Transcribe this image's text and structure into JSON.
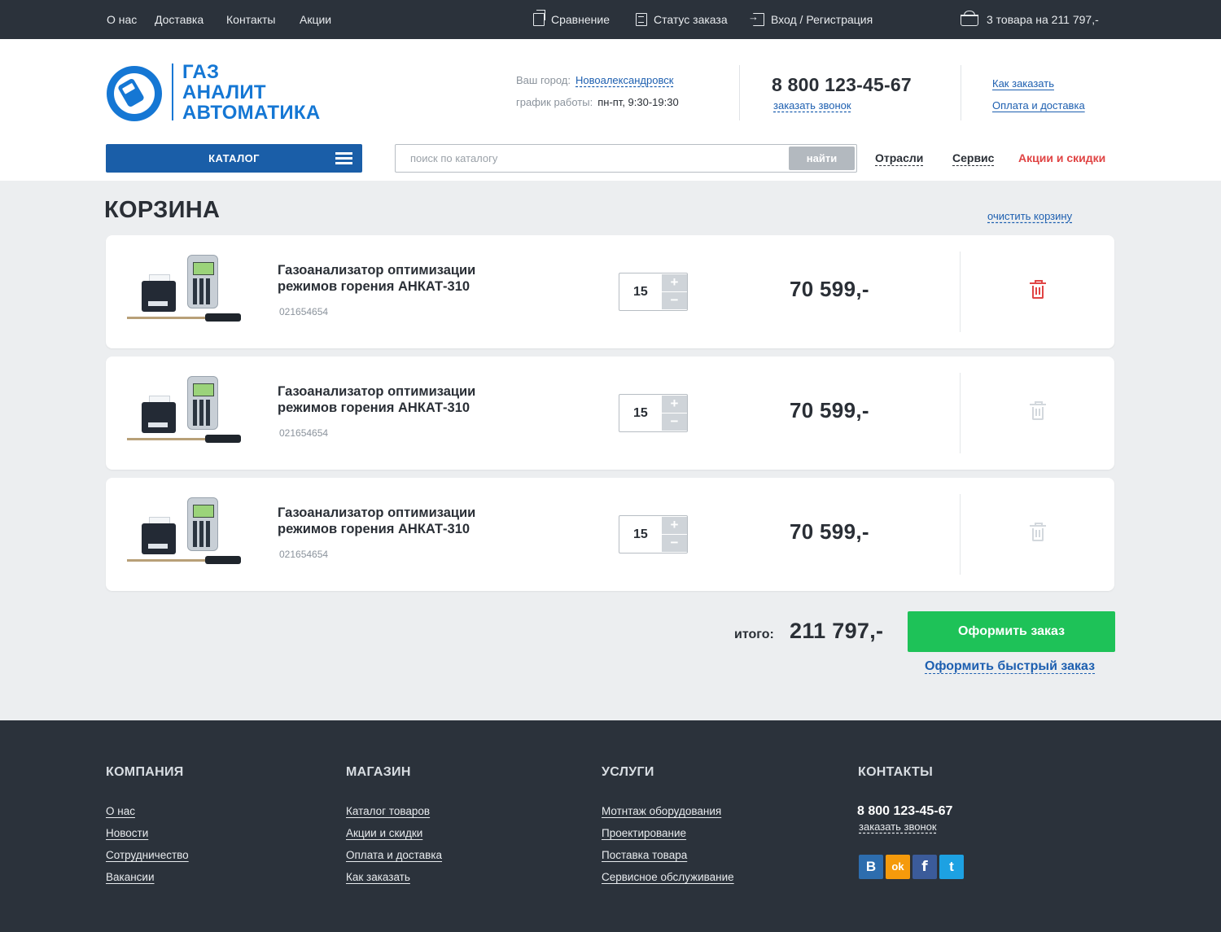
{
  "topbar": {
    "links": [
      "О нас",
      "Доставка",
      "Контакты",
      "Акции"
    ],
    "compare": "Сравнение",
    "order_status": "Статус заказа",
    "login": "Вход / Регистрация",
    "cart_summary": "3 товара на 211 797,-"
  },
  "header": {
    "logo_lines": [
      "ГАЗ",
      "АНАЛИТ",
      "АВТОМАТИКА"
    ],
    "city_label": "Ваш город:",
    "city_value": "Новоалександровск",
    "hours_label": "график работы:",
    "hours_value": "пн-пт, 9:30-19:30",
    "phone": "8 800 123-45-67",
    "callback": "заказать звонок",
    "how_to_order": "Как заказать",
    "payment_delivery": "Оплата и доставка",
    "catalog_button": "КАТАЛОГ",
    "search_placeholder": "поиск по каталогу",
    "search_button": "найти",
    "nav": [
      "Отрасли",
      "Сервис",
      "Акции и скидки"
    ]
  },
  "cart": {
    "title": "КОРЗИНА",
    "clear": "очистить корзину",
    "items": [
      {
        "name": "Газоанализатор оптимизации режимов горения АНКАТ-310",
        "sku": "021654654",
        "qty": "15",
        "price": "70 599,-"
      },
      {
        "name": "Газоанализатор оптимизации режимов горения АНКАТ-310",
        "sku": "021654654",
        "qty": "15",
        "price": "70 599,-"
      },
      {
        "name": "Газоанализатор оптимизации режимов горения АНКАТ-310",
        "sku": "021654654",
        "qty": "15",
        "price": "70 599,-"
      }
    ],
    "plus": "+",
    "minus": "−",
    "total_label": "итого:",
    "total_value": "211 797,-",
    "order_button": "Оформить заказ",
    "fast_order": "Оформить быстрый заказ"
  },
  "footer": {
    "columns": [
      {
        "title": "КОМПАНИЯ",
        "links": [
          "О нас",
          "Новости",
          "Сотрудничество",
          "Вакансии"
        ]
      },
      {
        "title": "МАГАЗИН",
        "links": [
          "Каталог товаров",
          "Акции и скидки",
          "Оплата и доставка",
          "Как заказать"
        ]
      },
      {
        "title": "УСЛУГИ",
        "links": [
          "Мотнтаж оборудования",
          "Проектирование",
          "Поставка товара",
          "Сервисное обслуживание"
        ]
      },
      {
        "title": "КОНТАКТЫ",
        "links": []
      }
    ],
    "phone": "8 800 123-45-67",
    "callback": "заказать звонок",
    "social": [
      {
        "icon": "vk-icon",
        "glyph": "В",
        "color": "#2d6dae"
      },
      {
        "icon": "ok-icon",
        "glyph": "ok",
        "color": "#f59a0b"
      },
      {
        "icon": "facebook-icon",
        "glyph": "f",
        "color": "#3b5b9a"
      },
      {
        "icon": "twitter-icon",
        "glyph": "t",
        "color": "#1da1e2"
      }
    ]
  },
  "colors": {
    "dark": "#2b323b",
    "brand_blue": "#1577d4",
    "catalog_blue": "#1a5ea8",
    "link_blue": "#1d5fb0",
    "accent_red": "#e04444",
    "order_green": "#1ec258"
  }
}
